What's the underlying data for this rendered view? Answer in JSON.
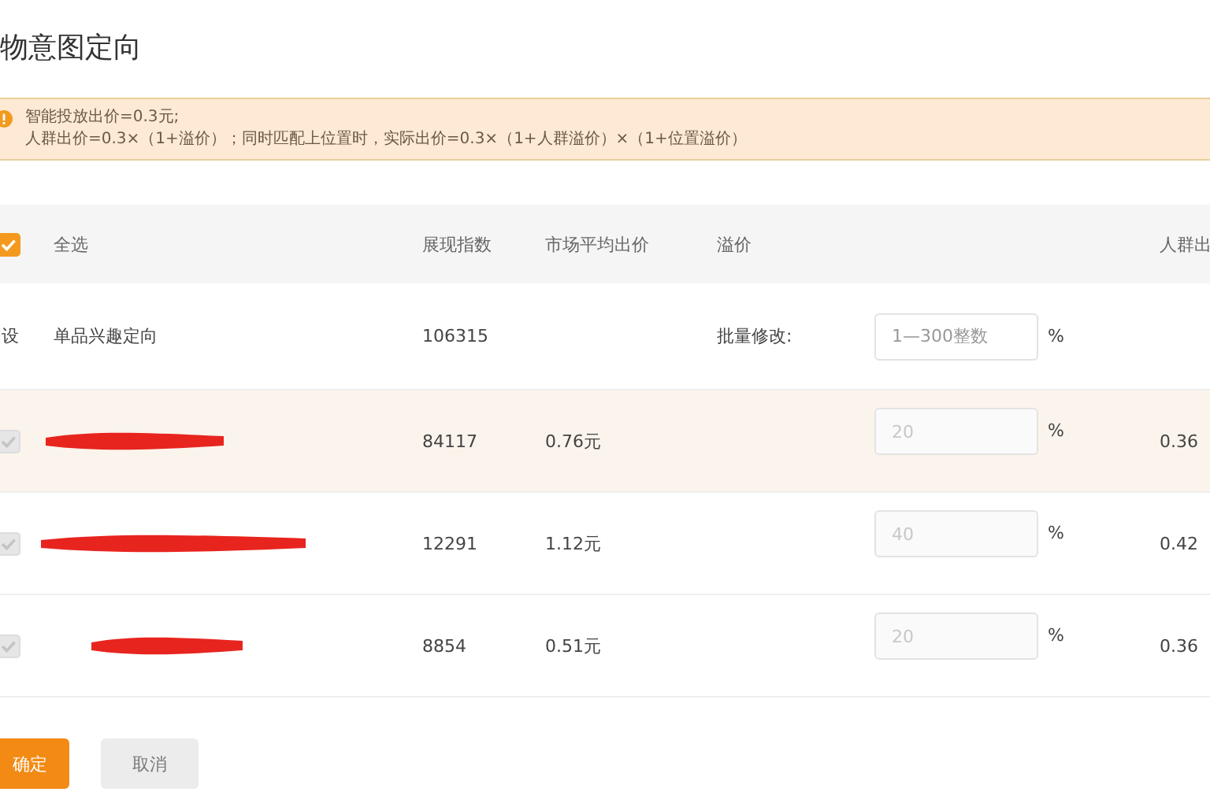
{
  "title": "物意图定向",
  "notice": {
    "lines": [
      "智能投放出价=0.3元;",
      "人群出价=0.3×（1+溢价）；同时匹配上位置时，实际出价=0.3×（1+人群溢价）×（1+位置溢价）"
    ]
  },
  "table": {
    "columns": [
      "全选",
      "展现指数",
      "市场平均出价",
      "溢价",
      "人群出"
    ],
    "select_all": {
      "checked": true
    },
    "batch_row": {
      "column_1": "设",
      "name": "单品兴趣定向",
      "index": "106315",
      "label": "批量修改:",
      "placeholder": "1—300整数",
      "unit": "%"
    },
    "rows": [
      {
        "checked": true,
        "disabled": true,
        "highlighted": true,
        "redacted": true,
        "index": "84117",
        "avg_bid": "0.76元",
        "premium": "20",
        "unit": "%",
        "crowd_bid": "0.36"
      },
      {
        "checked": true,
        "disabled": true,
        "highlighted": false,
        "redacted": true,
        "index": "12291",
        "avg_bid": "1.12元",
        "premium": "40",
        "unit": "%",
        "crowd_bid": "0.42"
      },
      {
        "checked": true,
        "disabled": true,
        "highlighted": false,
        "redacted": true,
        "index": "8854",
        "avg_bid": "0.51元",
        "premium": "20",
        "unit": "%",
        "crowd_bid": "0.36"
      }
    ]
  },
  "buttons": [
    {
      "label": "确定",
      "kind": "primary"
    },
    {
      "label": "取消",
      "kind": "secondary"
    }
  ]
}
